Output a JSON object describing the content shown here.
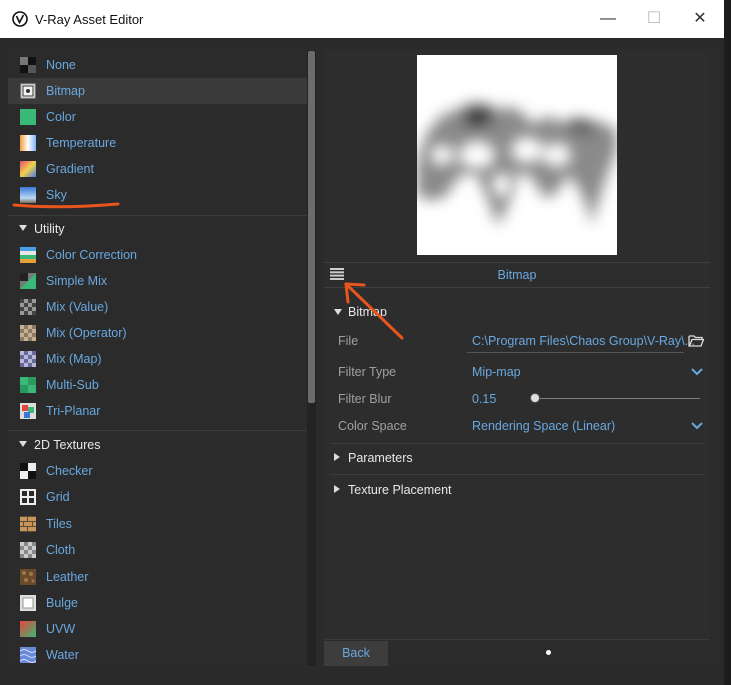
{
  "window": {
    "title": "V-Ray Asset Editor",
    "min_glyph": "—",
    "max_glyph": "☐",
    "close_glyph": "✕"
  },
  "left_panel": {
    "top_items": [
      {
        "label": "None",
        "icon": "none-texture-icon"
      },
      {
        "label": "Bitmap",
        "icon": "bitmap-texture-icon",
        "selected": true
      },
      {
        "label": "Color",
        "icon": "color-texture-icon"
      },
      {
        "label": "Temperature",
        "icon": "temperature-texture-icon"
      },
      {
        "label": "Gradient",
        "icon": "gradient-texture-icon"
      },
      {
        "label": "Sky",
        "icon": "sky-texture-icon"
      }
    ],
    "utility": {
      "label": "Utility",
      "items": [
        {
          "label": "Color Correction",
          "icon": "color-correction-icon"
        },
        {
          "label": "Simple Mix",
          "icon": "simple-mix-icon"
        },
        {
          "label": "Mix (Value)",
          "icon": "mix-value-icon"
        },
        {
          "label": "Mix (Operator)",
          "icon": "mix-operator-icon"
        },
        {
          "label": "Mix (Map)",
          "icon": "mix-map-icon"
        },
        {
          "label": "Multi-Sub",
          "icon": "multi-sub-icon"
        },
        {
          "label": "Tri-Planar",
          "icon": "tri-planar-icon"
        }
      ]
    },
    "textures_2d": {
      "label": "2D Textures",
      "items": [
        {
          "label": "Checker",
          "icon": "checker-icon"
        },
        {
          "label": "Grid",
          "icon": "grid-icon"
        },
        {
          "label": "Tiles",
          "icon": "tiles-icon"
        },
        {
          "label": "Cloth",
          "icon": "cloth-icon"
        },
        {
          "label": "Leather",
          "icon": "leather-icon"
        },
        {
          "label": "Bulge",
          "icon": "bulge-icon"
        },
        {
          "label": "UVW",
          "icon": "uvw-icon"
        },
        {
          "label": "Water",
          "icon": "water-icon"
        }
      ]
    }
  },
  "right_panel": {
    "header_label": "Bitmap",
    "section_bitmap": {
      "label": "Bitmap",
      "file_label": "File",
      "file_value": "C:\\Program Files\\Chaos Group\\V-Ray\\...",
      "filter_type_label": "Filter Type",
      "filter_type_value": "Mip-map",
      "filter_blur_label": "Filter Blur",
      "filter_blur_value": "0.15",
      "color_space_label": "Color Space",
      "color_space_value": "Rendering Space (Linear)"
    },
    "section_parameters": "Parameters",
    "section_texture_placement": "Texture Placement",
    "back_label": "Back"
  },
  "colors": {
    "accent": "#69a8e0",
    "annotation": "#e8561e",
    "background": "#2b2b2b"
  }
}
